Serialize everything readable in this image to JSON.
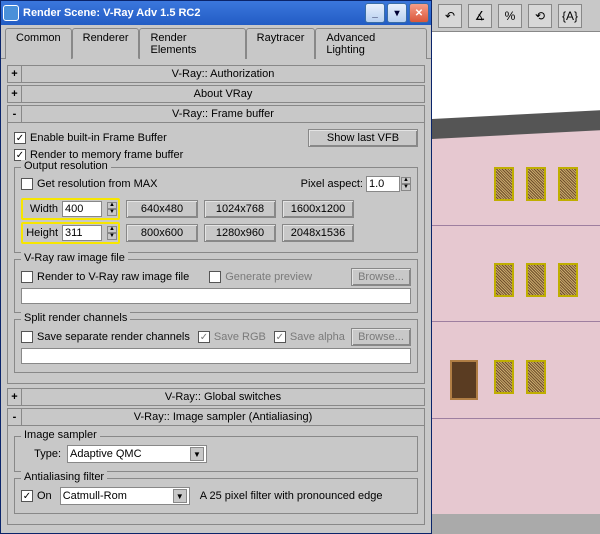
{
  "window": {
    "title": "Render Scene: V-Ray Adv 1.5 RC2"
  },
  "tabs": [
    "Common",
    "Renderer",
    "Render Elements",
    "Raytracer",
    "Advanced Lighting"
  ],
  "rollups": {
    "auth": "V-Ray:: Authorization",
    "about": "About VRay",
    "fb": "V-Ray:: Frame buffer",
    "global": "V-Ray:: Global switches",
    "imgsamp": "V-Ray:: Image sampler (Antialiasing)"
  },
  "fb": {
    "enable": "Enable built-in Frame Buffer",
    "showlast": "Show last VFB",
    "rendermem": "Render to memory frame buffer",
    "output": {
      "title": "Output resolution",
      "getmax": "Get resolution from MAX",
      "pixelaspect_lbl": "Pixel aspect:",
      "pixelaspect": "1.0",
      "width_lbl": "Width",
      "width": "400",
      "height_lbl": "Height",
      "height": "311",
      "presets": [
        "640x480",
        "1024x768",
        "1600x1200",
        "800x600",
        "1280x960",
        "2048x1536"
      ]
    },
    "raw": {
      "title": "V-Ray raw image file",
      "render": "Render to V-Ray raw image file",
      "gen": "Generate preview",
      "browse": "Browse..."
    },
    "split": {
      "title": "Split render channels",
      "save": "Save separate render channels",
      "rgb": "Save RGB",
      "alpha": "Save alpha",
      "browse": "Browse..."
    }
  },
  "imgsamp": {
    "sampler_title": "Image sampler",
    "type_lbl": "Type:",
    "type": "Adaptive QMC",
    "aa_title": "Antialiasing filter",
    "on": "On",
    "filter": "Catmull-Rom",
    "desc": "A 25 pixel filter with pronounced edge"
  },
  "vp_icons": [
    "↶",
    "∡",
    "%",
    "⟲",
    "{A}"
  ]
}
